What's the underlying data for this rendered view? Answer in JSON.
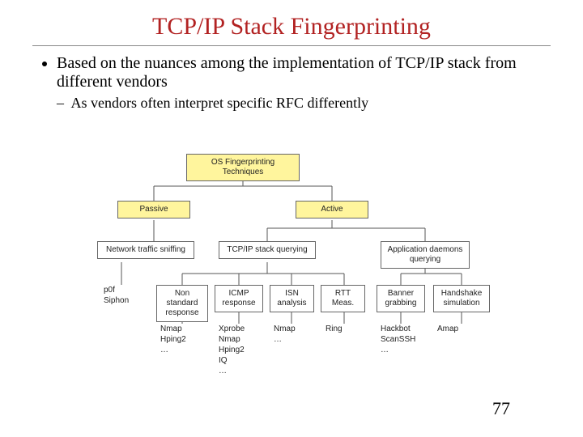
{
  "title": "TCP/IP Stack Fingerprinting",
  "bullets": {
    "b1": "Based on the nuances among the implementation of TCP/IP stack from different vendors",
    "b2": "As vendors often interpret specific RFC differently"
  },
  "diagram": {
    "root": "OS Fingerprinting Techniques",
    "cat_passive": "Passive",
    "cat_active": "Active",
    "passive_leaf": "Network traffic sniffing",
    "passive_tools": "p0f\nSiphon",
    "active_stack": "TCP/IP stack querying",
    "active_app": "Application daemons querying",
    "stack_nonstd": "Non standard response",
    "stack_icmp": "ICMP response",
    "stack_isn": "ISN analysis",
    "stack_rtt": "RTT Meas.",
    "app_banner": "Banner grabbing",
    "app_hand": "Handshake simulation",
    "tools_nonstd": "Nmap\nHping2\n…",
    "tools_icmp": "Xprobe\nNmap\nHping2\nIQ\n…",
    "tools_isn": "Nmap\n…",
    "tools_rtt": "Ring",
    "tools_banner": "Hackbot\nScanSSH\n…",
    "tools_hand": "Amap"
  },
  "page": "77"
}
